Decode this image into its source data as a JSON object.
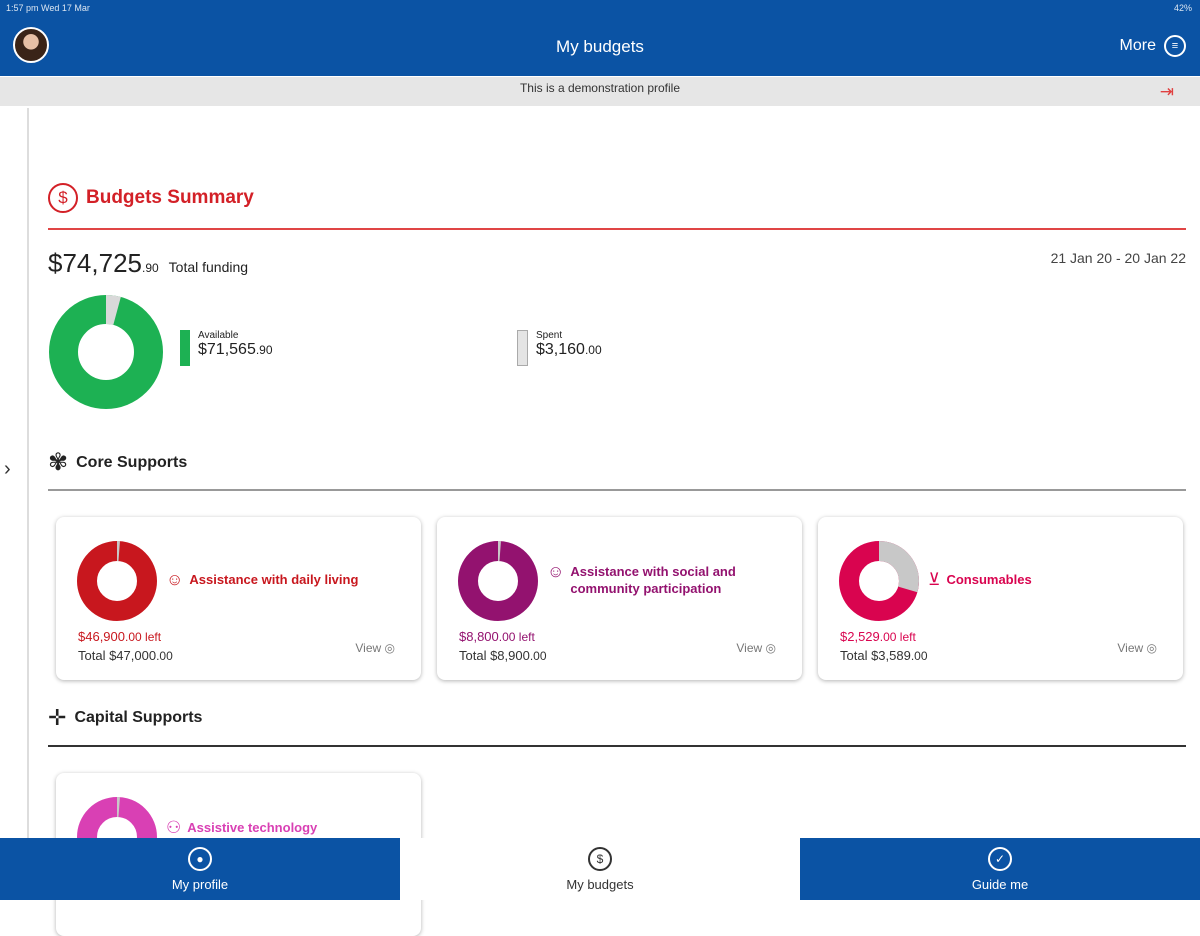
{
  "status_bar": {
    "time": "1:57 pm  Wed 17 Mar",
    "battery": "42%"
  },
  "header": {
    "title": "My budgets",
    "more_label": "More"
  },
  "banner": {
    "text": "This is a demonstration profile"
  },
  "summary": {
    "title": "Budgets Summary",
    "total_dollars": "$74,725",
    "total_cents": ".90",
    "total_label": "Total funding",
    "date_range": "21 Jan 20 - 20 Jan 22",
    "available_label": "Available",
    "available_dollars": "$71,565",
    "available_cents": ".90",
    "spent_label": "Spent",
    "spent_dollars": "$3,160",
    "spent_cents": ".00",
    "spent_fraction": 0.042,
    "colors": {
      "available": "#1db153",
      "spent": "#d9d9d9"
    }
  },
  "core": {
    "title": "Core Supports",
    "cards": [
      {
        "name": "Assistance with daily living",
        "left_dollars": "$46,900",
        "left_cents": ".00",
        "left_suffix": " left",
        "total_prefix": "Total ",
        "total_dollars": "$47,000",
        "total_cents": ".00",
        "view": "View",
        "color": "#c8171e",
        "spent_fraction": 0.002,
        "icon": "hands-icon"
      },
      {
        "name": "Assistance with social and community participation",
        "left_dollars": "$8,800",
        "left_cents": ".00",
        "left_suffix": " left",
        "total_prefix": "Total ",
        "total_dollars": "$8,900",
        "total_cents": ".00",
        "view": "View",
        "color": "#93126f",
        "spent_fraction": 0.011,
        "icon": "people-icon"
      },
      {
        "name": "Consumables",
        "left_dollars": "$2,529",
        "left_cents": ".00",
        "left_suffix": " left",
        "total_prefix": "Total ",
        "total_dollars": "$3,589",
        "total_cents": ".00",
        "view": "View",
        "color": "#d9044f",
        "spent_fraction": 0.295,
        "icon": "basket-icon"
      }
    ]
  },
  "capital": {
    "title": "Capital Supports",
    "cards": [
      {
        "name": "Assistive technology",
        "color": "#d940b4",
        "spent_fraction": 0.01
      }
    ]
  },
  "bottom_nav": [
    {
      "label": "My profile"
    },
    {
      "label": "My budgets"
    },
    {
      "label": "Guide me"
    }
  ]
}
